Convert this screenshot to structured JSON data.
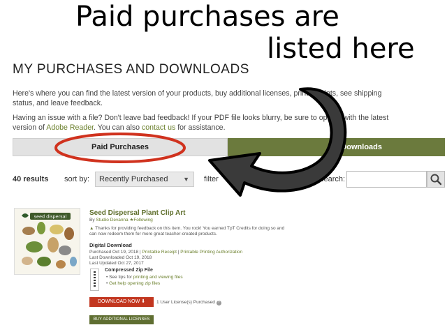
{
  "overlay": {
    "line1": "Paid purchases are",
    "line2": "listed here"
  },
  "page": {
    "title": "MY PURCHASES AND DOWNLOADS",
    "intro1": "Here's where you can find the latest version of your products, buy additional licenses, print receipts, see shipping status, and leave feedback.",
    "intro2_pre": "Having an issue with a file? Don't leave bad feedback! If your PDF file looks blurry, be sure to open it with the latest version of ",
    "intro2_link1": "Adobe Reader",
    "intro2_mid": ". You can also ",
    "intro2_link2": "contact us",
    "intro2_post": " for assistance."
  },
  "tabs": {
    "paid": "Paid Purchases",
    "downloads": "Downloads"
  },
  "toolbar": {
    "results": "40 results",
    "sort_label": "sort by:",
    "sort_value": "Recently Purchased",
    "filter_label": "filter",
    "search_label": "search:"
  },
  "product": {
    "title": "Seed Dispersal Plant Clip Art",
    "by": "By",
    "seller": "Studio Devanna",
    "following": "Following",
    "thumb_label": "seed dispersal",
    "feedback_line1": "Thanks for providing feedback on this item. You rock! You earned TpT Credits for doing so and",
    "feedback_line2": "can now redeem them for more great teacher-created products.",
    "section": "Digital Download",
    "purchased": "Purchased Oct 19, 2018",
    "receipt_link": "Printable Receipt",
    "auth_link": "Printable Printing Authorization",
    "last_downloaded": "Last Downloaded Oct 19, 2018",
    "last_updated": "Last Updated Oct 27, 2017",
    "zip_title": "Compressed Zip File",
    "zip_tip1_pre": "See tips for ",
    "zip_tip1_link": "printing and viewing files",
    "zip_tip2_link": "Get help opening zip files",
    "download_btn": "DOWNLOAD NOW",
    "license_note": "1 User License(s) Purchased",
    "buy_btn": "BUY ADDITIONAL LICENSES"
  },
  "colors": {
    "accent_green": "#6b7a3d",
    "download_red": "#c2361f",
    "annotation_red": "#d0321e"
  }
}
